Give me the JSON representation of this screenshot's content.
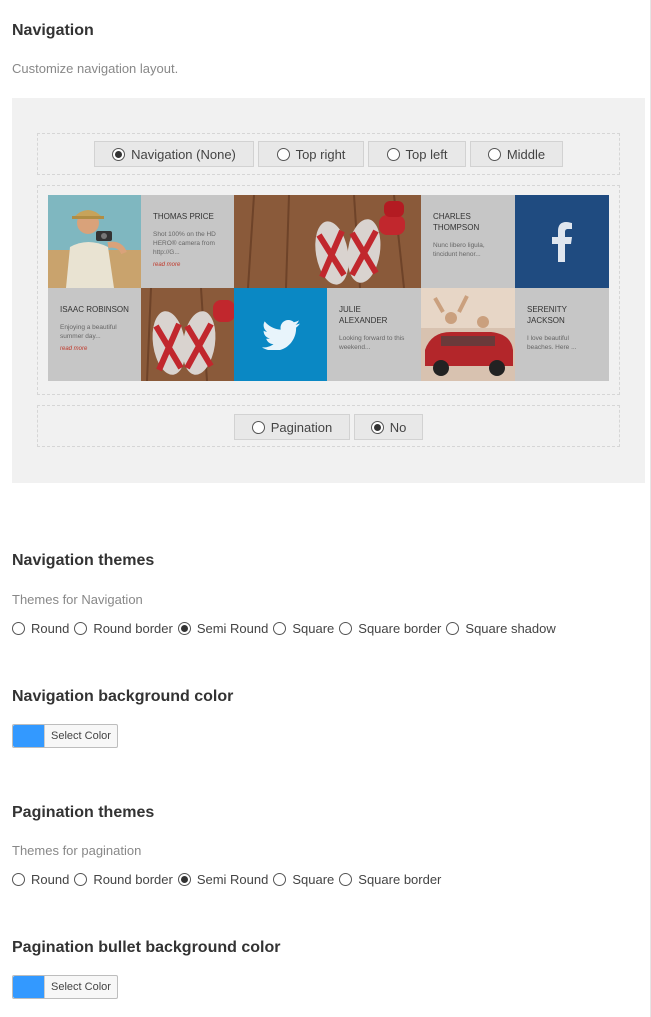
{
  "navigation": {
    "title": "Navigation",
    "description": "Customize navigation layout.",
    "position_options": [
      {
        "label": "Navigation (None)",
        "selected": true
      },
      {
        "label": "Top right",
        "selected": false
      },
      {
        "label": "Top left",
        "selected": false
      },
      {
        "label": "Middle",
        "selected": false
      }
    ],
    "pagination_options": [
      {
        "label": "Pagination",
        "selected": false
      },
      {
        "label": "No",
        "selected": true
      }
    ],
    "tiles": [
      {
        "kind": "photo",
        "icon": "photographer-photo"
      },
      {
        "kind": "text",
        "name": "THOMAS PRICE",
        "snippet": "Shot 100% on the HD HERO® camera from http://G...",
        "more": "read more"
      },
      {
        "kind": "photo",
        "icon": "flip-flops-photo"
      },
      {
        "kind": "text",
        "name": "CHARLES THOMPSON",
        "snippet": "Nunc libero ligula, tincidunt henor...",
        "more": ""
      },
      {
        "kind": "social",
        "icon": "facebook-icon",
        "color": "#1f4b80"
      },
      {
        "kind": "text",
        "name": "ISAAC ROBINSON",
        "snippet": "Enjoying a beautiful summer day...",
        "more": "read more"
      },
      {
        "kind": "photo",
        "icon": "flip-flops-photo"
      },
      {
        "kind": "social",
        "icon": "twitter-icon",
        "color": "#0a88c4"
      },
      {
        "kind": "text",
        "name": "JULIE ALEXANDER",
        "snippet": "Looking forward to this weekend...",
        "more": ""
      },
      {
        "kind": "photo",
        "icon": "red-car-photo"
      },
      {
        "kind": "text",
        "name": "SERENITY JACKSON",
        "snippet": "I love beautiful beaches. Here ...",
        "more": ""
      }
    ]
  },
  "navigation_themes": {
    "title": "Navigation themes",
    "description": "Themes for Navigation",
    "options": [
      {
        "label": "Round",
        "selected": false
      },
      {
        "label": "Round border",
        "selected": false
      },
      {
        "label": "Semi Round",
        "selected": true
      },
      {
        "label": "Square",
        "selected": false
      },
      {
        "label": "Square border",
        "selected": false
      },
      {
        "label": "Square shadow",
        "selected": false
      }
    ]
  },
  "navigation_bg": {
    "title": "Navigation background color",
    "button_label": "Select Color",
    "color": "#3399ff"
  },
  "pagination_themes": {
    "title": "Pagination themes",
    "description": "Themes for pagination",
    "options": [
      {
        "label": "Round",
        "selected": false
      },
      {
        "label": "Round border",
        "selected": false
      },
      {
        "label": "Semi Round",
        "selected": true
      },
      {
        "label": "Square",
        "selected": false
      },
      {
        "label": "Square border",
        "selected": false
      }
    ]
  },
  "pagination_bg": {
    "title": "Pagination bullet background color",
    "button_label": "Select Color",
    "color": "#3399ff"
  }
}
